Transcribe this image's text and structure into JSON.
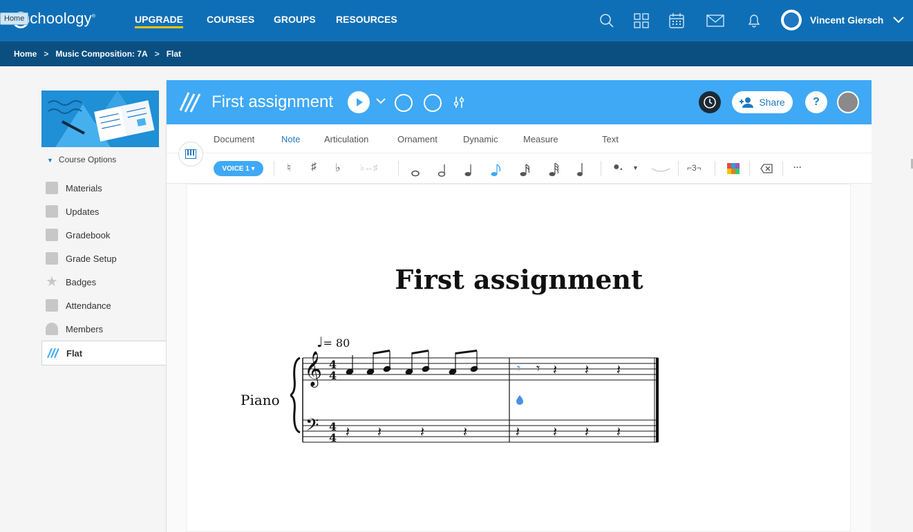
{
  "topbar": {
    "home_tooltip": "Home",
    "logo": "schoology",
    "nav": [
      {
        "label": "UPGRADE"
      },
      {
        "label": "COURSES"
      },
      {
        "label": "GROUPS"
      },
      {
        "label": "RESOURCES"
      }
    ],
    "icons": [
      "search-icon",
      "apps-grid-icon",
      "calendar-icon",
      "mail-icon",
      "notification-bell-icon"
    ],
    "user_name": "Vincent Giersch"
  },
  "breadcrumb": [
    "Home",
    "Music Composition: 7A",
    "Flat"
  ],
  "breadcrumb_sep": ">",
  "sidebar": {
    "course_options": "Course Options",
    "items": [
      {
        "label": "Materials"
      },
      {
        "label": "Updates"
      },
      {
        "label": "Gradebook"
      },
      {
        "label": "Grade Setup"
      },
      {
        "label": "Badges"
      },
      {
        "label": "Attendance"
      },
      {
        "label": "Members"
      },
      {
        "label": "Flat"
      }
    ]
  },
  "flat": {
    "title": "First assignment",
    "share_label": "Share",
    "tabs": [
      {
        "label": "Document"
      },
      {
        "label": "Note"
      },
      {
        "label": "Articulation"
      },
      {
        "label": "Ornament"
      },
      {
        "label": "Dynamic"
      },
      {
        "label": "Measure"
      },
      {
        "label": "Text"
      }
    ],
    "voice_label": "VOICE 1",
    "toolbar": {
      "natural": "♮",
      "sharp": "♯",
      "flat": "♭",
      "enharmonic": "♭↔♯",
      "tuplet": "⌐3¬",
      "more": "···"
    },
    "colors": {
      "header": "#3fa9f5",
      "accent": "#1f78c1",
      "selected": "#4a90e2"
    }
  },
  "score": {
    "title": "First assignment",
    "tempo_value": "= 80",
    "instrument": "Piano",
    "time_signature": "4/4"
  }
}
